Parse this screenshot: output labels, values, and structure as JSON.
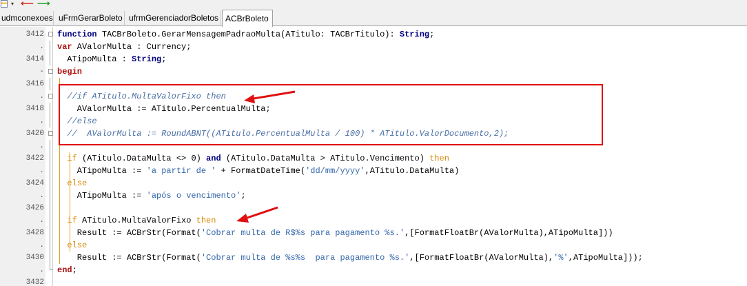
{
  "toolbar": {
    "icons": [
      "document-icon",
      "dropdown-arrow-icon",
      "back-arrow-icon",
      "forward-arrow-icon"
    ],
    "drop_glyph": "▾",
    "back_glyph": "⟵",
    "fwd_glyph": "⟶"
  },
  "tabs": [
    {
      "label": "udmconexoes"
    },
    {
      "label": "uFrmGerarBoleto"
    },
    {
      "label": "ufrmGerenciadorBoletos"
    },
    {
      "label": "ACBrBoleto",
      "active": true
    }
  ],
  "lines": [
    {
      "num": "3412",
      "segs": [
        [
          "kw",
          "function "
        ],
        [
          "",
          "TACBrBoleto.GerarMensagemPadraoMulta(ATitulo: TACBrTitulo): "
        ],
        [
          "kw2",
          "String"
        ],
        [
          "",
          ";"
        ]
      ]
    },
    {
      "num": ".",
      "segs": [
        [
          "kwr",
          "var"
        ],
        [
          "",
          " AValorMulta : Currency;"
        ]
      ]
    },
    {
      "num": "3414",
      "segs": [
        [
          "",
          "  ATipoMulta : "
        ],
        [
          "kw2",
          "String"
        ],
        [
          "",
          ";"
        ]
      ]
    },
    {
      "num": "-",
      "segs": [
        [
          "kwr",
          "begin"
        ]
      ]
    },
    {
      "num": "3416",
      "segs": []
    },
    {
      "num": ".",
      "segs": [
        [
          "cm",
          "  //if ATitulo.MultaValorFixo then"
        ]
      ]
    },
    {
      "num": "3418",
      "segs": [
        [
          "",
          "    AValorMulta := ATitulo.PercentualMulta;"
        ]
      ]
    },
    {
      "num": ".",
      "segs": [
        [
          "cm",
          "  //else"
        ]
      ]
    },
    {
      "num": "3420",
      "segs": [
        [
          "cm",
          "  //  AValorMulta := RoundABNT((ATitulo.PercentualMulta / 100) * ATitulo.ValorDocumento,2);"
        ]
      ]
    },
    {
      "num": ".",
      "segs": []
    },
    {
      "num": "3422",
      "segs": [
        [
          "kwo",
          "  if"
        ],
        [
          "",
          " (ATitulo.DataMulta <> 0) "
        ],
        [
          "kw",
          "and"
        ],
        [
          "",
          " (ATitulo.DataMulta > ATitulo.Vencimento) "
        ],
        [
          "kwo",
          "then"
        ]
      ]
    },
    {
      "num": ".",
      "segs": [
        [
          "",
          "    ATipoMulta := "
        ],
        [
          "str",
          "'a partir de '"
        ],
        [
          "",
          " + FormatDateTime("
        ],
        [
          "str",
          "'dd/mm/yyyy'"
        ],
        [
          "",
          ",ATitulo.DataMulta)"
        ]
      ]
    },
    {
      "num": "3424",
      "segs": [
        [
          "kwo",
          "  else"
        ]
      ]
    },
    {
      "num": ".",
      "segs": [
        [
          "",
          "    ATipoMulta := "
        ],
        [
          "str",
          "'após o vencimento'"
        ],
        [
          "",
          ";"
        ]
      ]
    },
    {
      "num": "3426",
      "segs": []
    },
    {
      "num": ".",
      "segs": [
        [
          "kwo",
          "  if"
        ],
        [
          "",
          " ATitulo.MultaValorFixo "
        ],
        [
          "kwo",
          "then"
        ]
      ]
    },
    {
      "num": "3428",
      "segs": [
        [
          "",
          "    Result := ACBrStr(Format("
        ],
        [
          "str",
          "'Cobrar multa de R$%s para pagamento %s.'"
        ],
        [
          "",
          ",[FormatFloatBr(AValorMulta),ATipoMulta]))"
        ]
      ]
    },
    {
      "num": ".",
      "segs": [
        [
          "kwo",
          "  else"
        ]
      ]
    },
    {
      "num": "3430",
      "segs": [
        [
          "",
          "    Result := ACBrStr(Format("
        ],
        [
          "str",
          "'Cobrar multa de %s%s  para pagamento %s.'"
        ],
        [
          "",
          ",[FormatFloatBr(AValorMulta),"
        ],
        [
          "str",
          "'%'"
        ],
        [
          "",
          ",ATipoMulta]));"
        ]
      ]
    },
    {
      "num": ".",
      "segs": [
        [
          "kwr",
          "end"
        ],
        [
          "",
          ";"
        ]
      ]
    },
    {
      "num": "3432",
      "segs": []
    }
  ],
  "annotations": {
    "box_color": "#e01010",
    "arrow_color": "#e01010"
  }
}
